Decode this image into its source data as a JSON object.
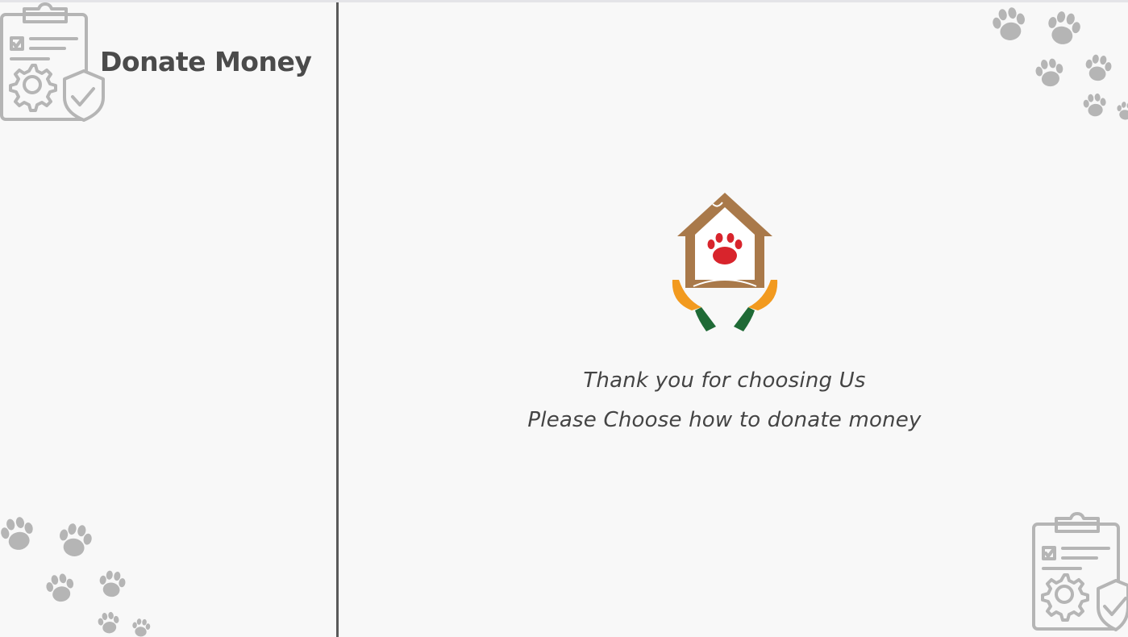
{
  "sidebar": {
    "title": "Donate Money"
  },
  "main": {
    "line1": "Thank you for choosing Us",
    "line2": "Please Choose how to donate money"
  },
  "colors": {
    "background": "#f8f8f8",
    "divider": "#5a5a5a",
    "decoration_gray": "#b5b5b5",
    "logo_brown": "#a9794a",
    "logo_paw_red": "#d8242c",
    "logo_orange": "#f29a1f",
    "logo_green": "#1f6a36"
  },
  "icons": {
    "decor_top_left": "clipboard-gear-shield-icon",
    "decor_bottom_right": "clipboard-gear-shield-icon",
    "decor_top_right": "paw-prints-icon",
    "decor_bottom_left": "paw-prints-icon",
    "logo": "house-paw-hands-logo"
  }
}
